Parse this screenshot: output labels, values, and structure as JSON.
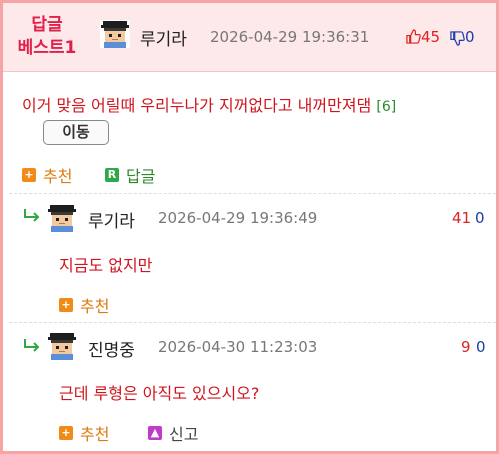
{
  "best": {
    "badge_line1": "답글",
    "badge_line2": "베스트1",
    "username": "루기라",
    "timestamp": "2026-04-29 19:36:31",
    "upvotes": "45",
    "downvotes": "0",
    "comment": "이거 맞음 어릴때 우리누나가 지꺼없다고 내꺼만져댐",
    "reply_count": "[6]",
    "move_label": "이동",
    "recommend_label": "추천",
    "reply_label": "답글"
  },
  "replies": [
    {
      "username": "루기라",
      "timestamp": "2026-04-29 19:36:49",
      "upvotes": "41",
      "downvotes": "0",
      "text": "지금도 없지만",
      "recommend_label": "추천"
    },
    {
      "username": "진명중",
      "timestamp": "2026-04-30 11:23:03",
      "upvotes": "9",
      "downvotes": "0",
      "text": "근데 루형은 아직도 있으시오?",
      "recommend_label": "추천",
      "report_label": "신고"
    }
  ],
  "colors": {
    "accent_red": "#d1141e",
    "badge_pink": "#e0204a",
    "header_bg": "#fde8ea",
    "border": "#f5a3a3",
    "recommend_orange": "#e07b0c",
    "reply_green": "#2a8a2a",
    "downvote_blue": "#1a3da8"
  },
  "icons": {
    "upvote": "thumbs-up-icon",
    "downvote": "thumbs-down-icon",
    "recommend": "plus-icon",
    "reply": "reply-r-icon",
    "report": "report-icon",
    "reply_arrow": "reply-arrow-icon",
    "avatar": "pixel-avatar-icon"
  }
}
